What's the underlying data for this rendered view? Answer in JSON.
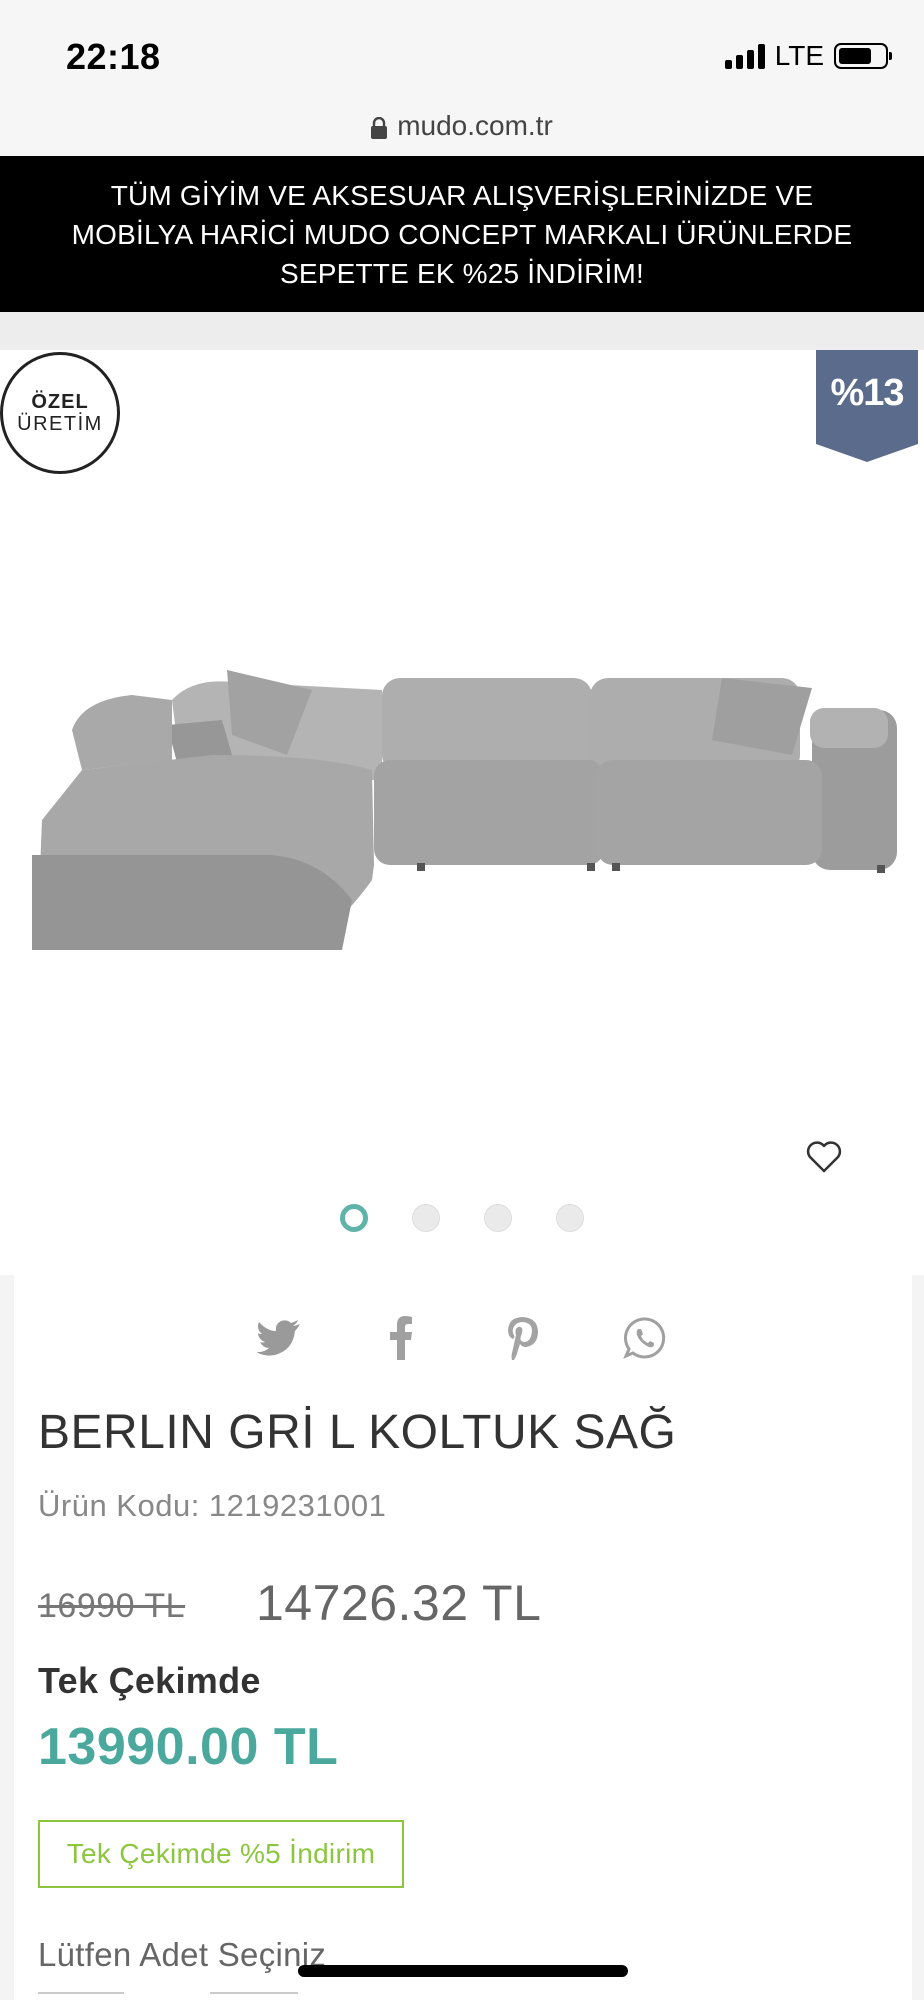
{
  "status_bar": {
    "time": "22:18",
    "network": "LTE"
  },
  "browser": {
    "url": "mudo.com.tr"
  },
  "promo_banner": {
    "text": "TÜM GİYİM VE AKSESUAR ALIŞVERİŞLERİNİZDE VE MOBİLYA HARİCİ MUDO CONCEPT MARKALI ÜRÜNLERDE SEPETTE EK %25 İNDİRİM!"
  },
  "badges": {
    "custom_line1": "ÖZEL",
    "custom_line2": "ÜRETİM",
    "discount": "%13"
  },
  "carousel": {
    "total": 4,
    "active": 0
  },
  "product": {
    "title": "BERLIN GRİ L KOLTUK SAĞ",
    "code": "Ürün Kodu: 1219231001",
    "old_price": "16990 TL",
    "new_price": "14726.32 TL",
    "single_payment_label": "Tek Çekimde",
    "single_payment_price": "13990.00 TL",
    "single_payment_discount": "Tek Çekimde %5 İndirim",
    "quantity_label": "Lütfen Adet Seçiniz"
  },
  "colors": {
    "accent_teal": "#4aa89c",
    "accent_green": "#8cc63f",
    "ribbon": "#5b6b8c"
  }
}
